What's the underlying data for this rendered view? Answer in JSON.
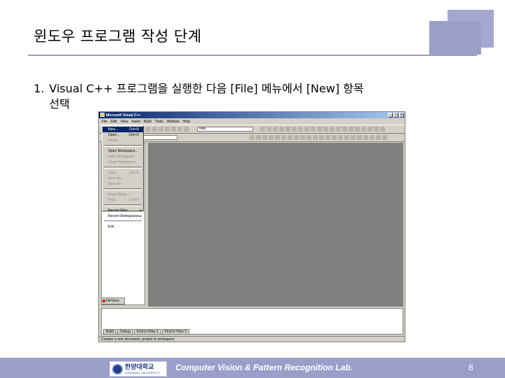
{
  "slide": {
    "title": "윈도우 프로그램 작성 단계",
    "step_number": "1.",
    "step_text_line1": "Visual C++ 프로그램을 실행한 다음 [File] 메뉴에서 [New] 항목",
    "step_text_line2": "선택",
    "footer_lab": "Computer Vision & Pattern Recognition Lab.",
    "page_number": "8",
    "accent_color": "#9b9ec9"
  },
  "logo": {
    "korean": "한양대학교",
    "english": "HANYANG UNIVERSITY"
  },
  "window": {
    "title": "Microsoft Visual C++",
    "menu": [
      "File",
      "Edit",
      "View",
      "Insert",
      "Build",
      "Tools",
      "Window",
      "Help"
    ],
    "find_combo": "new",
    "status": "Creates a new document, project or workspace",
    "workspace_tab": "FileView",
    "output_tabs": [
      "Build",
      "Debug",
      "Find in Files 1",
      "Find in Files 2"
    ]
  },
  "file_menu": {
    "new_label": "New...",
    "new_shortcut": "Ctrl+N",
    "open_label": "Open...",
    "open_shortcut": "Ctrl+O",
    "close_label": "Close",
    "open_workspace_label": "Open Workspace...",
    "save_workspace_label": "Save Workspace",
    "close_workspace_label": "Close Workspace",
    "save_label": "Save",
    "save_shortcut": "Ctrl+S",
    "save_as_label": "Save As...",
    "save_all_label": "Save All",
    "page_setup_label": "Page Setup...",
    "print_label": "Print...",
    "print_shortcut": "Ctrl+P",
    "recent_files_label": "Recent Files",
    "recent_workspaces_label": "Recent Workspaces",
    "exit_label": "Exit"
  }
}
